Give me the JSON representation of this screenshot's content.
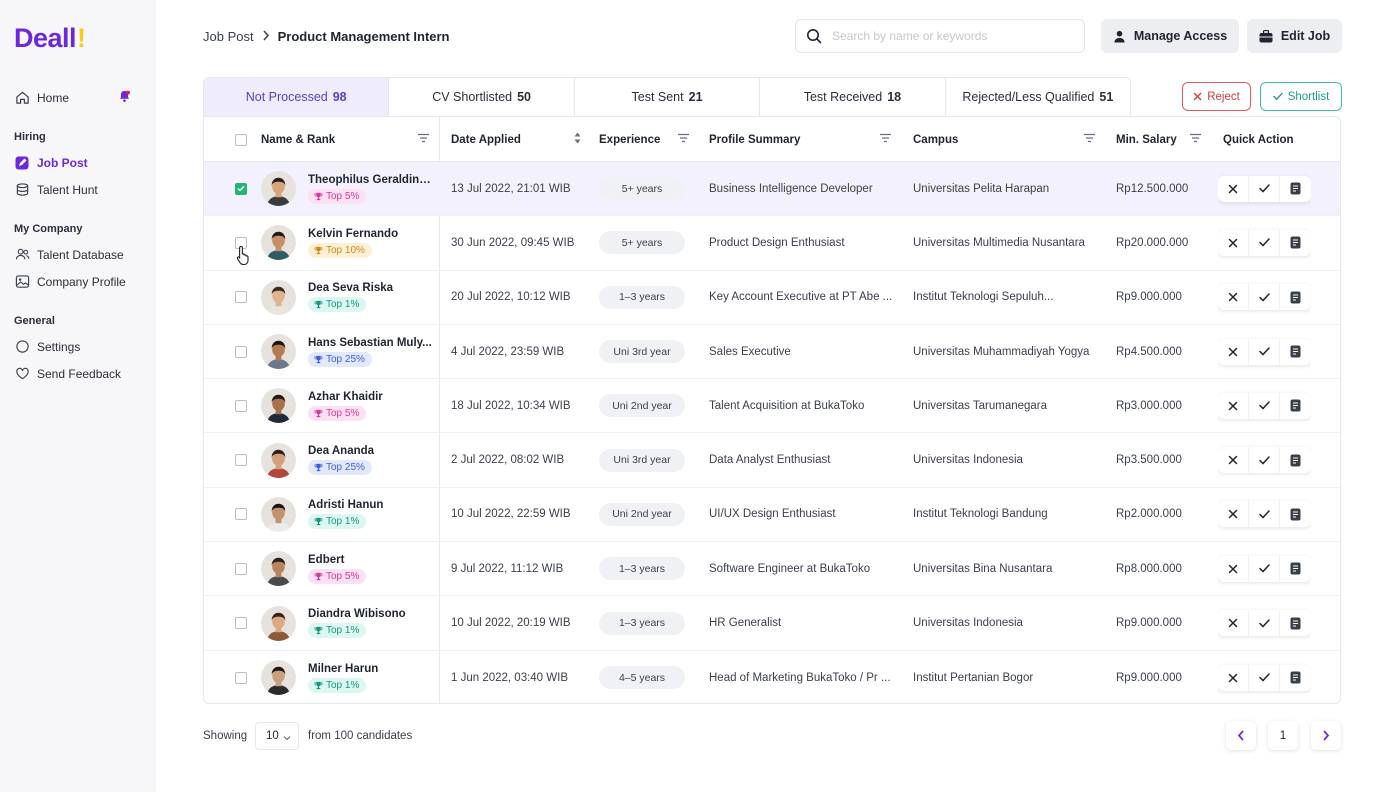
{
  "app": {
    "logo_text": "Deall",
    "logo_accent": "!",
    "brand_color": "#6d28d9"
  },
  "sidebar": {
    "home": "Home",
    "sections": [
      {
        "title": "Hiring",
        "items": [
          "Job Post",
          "Talent Hunt"
        ]
      },
      {
        "title": "My Company",
        "items": [
          "Talent Database",
          "Company Profile"
        ]
      },
      {
        "title": "General",
        "items": [
          "Settings",
          "Send Feedback"
        ]
      }
    ],
    "active_item": "Job Post"
  },
  "header": {
    "breadcrumb": [
      "Job Post",
      "Product Management Intern"
    ],
    "search_placeholder": "Search by name or keywords",
    "manage_access": "Manage Access",
    "edit_job": "Edit Job"
  },
  "tabs": [
    {
      "label": "Not Processed",
      "count": "98",
      "active": true
    },
    {
      "label": "CV Shortlisted",
      "count": "50"
    },
    {
      "label": "Test Sent",
      "count": "21"
    },
    {
      "label": "Test Received",
      "count": "18"
    },
    {
      "label": "Rejected/Less Qualified",
      "count": "51"
    }
  ],
  "actions": {
    "reject": "Reject",
    "shortlist": "Shortlist"
  },
  "columns": [
    "Name & Rank",
    "Date Applied",
    "Experience",
    "Profile Summary",
    "Campus",
    "Min. Salary",
    "Quick Action"
  ],
  "rows": [
    {
      "name": "Theophilus Geraldine...",
      "rank": "Top 5%",
      "date": "13 Jul 2022, 21:01 WIB",
      "experience": "5+ years",
      "summary": "Business Intelligence Developer",
      "campus": "Universitas Pelita Harapan",
      "salary": "Rp12.500.000",
      "checked": true
    },
    {
      "name": "Kelvin Fernando",
      "rank": "Top 10%",
      "date": "30 Jun 2022, 09:45 WIB",
      "experience": "5+ years",
      "summary": "Product Design Enthusiast",
      "campus": "Universitas Multimedia Nusantara",
      "salary": "Rp20.000.000"
    },
    {
      "name": "Dea Seva Riska",
      "rank": "Top 1%",
      "date": "20 Jul 2022, 10:12 WIB",
      "experience": "1–3 years",
      "summary": "Key Account Executive at PT Abe ...",
      "campus": "Institut Teknologi Sepuluh...",
      "salary": "Rp9.000.000"
    },
    {
      "name": "Hans Sebastian Muly...",
      "rank": "Top 25%",
      "date": "4 Jul 2022, 23:59 WIB",
      "experience": "Uni 3rd year",
      "summary": "Sales Executive",
      "campus": "Universitas Muhammadiyah Yogya",
      "salary": "Rp4.500.000"
    },
    {
      "name": "Azhar Khaidir",
      "rank": "Top 5%",
      "date": "18 Jul 2022, 10:34 WIB",
      "experience": "Uni 2nd year",
      "summary": "Talent Acquisition at BukaToko",
      "campus": "Universitas Tarumanegara",
      "salary": "Rp3.000.000"
    },
    {
      "name": "Dea Ananda",
      "rank": "Top 25%",
      "date": "2 Jul 2022, 08:02 WIB",
      "experience": "Uni 3rd year",
      "summary": "Data Analyst Enthusiast",
      "campus": "Universitas Indonesia",
      "salary": "Rp3.500.000"
    },
    {
      "name": "Adristi Hanun",
      "rank": "Top 1%",
      "date": "10 Jul 2022, 22:59 WIB",
      "experience": "Uni 2nd year",
      "summary": "UI/UX Design Enthusiast",
      "campus": "Institut Teknologi Bandung",
      "salary": "Rp2.000.000"
    },
    {
      "name": "Edbert",
      "rank": "Top 5%",
      "date": "9 Jul 2022, 11:12 WIB",
      "experience": "1–3 years",
      "summary": "Software Engineer at BukaToko",
      "campus": "Universitas Bina Nusantara",
      "salary": "Rp8.000.000"
    },
    {
      "name": "Diandra Wibisono",
      "rank": "Top 1%",
      "date": "10 Jul 2022, 20:19 WIB",
      "experience": "1–3 years",
      "summary": "HR Generalist",
      "campus": "Universitas Indonesia",
      "salary": "Rp9.000.000"
    },
    {
      "name": "Milner Harun",
      "rank": "Top 1%",
      "date": "1 Jun 2022, 03:40 WIB",
      "experience": "4–5 years",
      "summary": "Head of Marketing BukaToko / Pr ...",
      "campus": "Institut Pertanian Bogor",
      "salary": "Rp9.000.000"
    }
  ],
  "badge_colors": {
    "Top 1%": {
      "bg": "#dcf7f1",
      "fg": "#15977f"
    },
    "Top 5%": {
      "bg": "#fde0f1",
      "fg": "#d4399a"
    },
    "Top 10%": {
      "bg": "#fdf0d5",
      "fg": "#d08a12"
    },
    "Top 25%": {
      "bg": "#e2e8fd",
      "fg": "#3d5fd9"
    }
  },
  "footer": {
    "showing": "Showing",
    "page_size": "10",
    "from_text": "from 100 candidates",
    "current_page": "1"
  }
}
